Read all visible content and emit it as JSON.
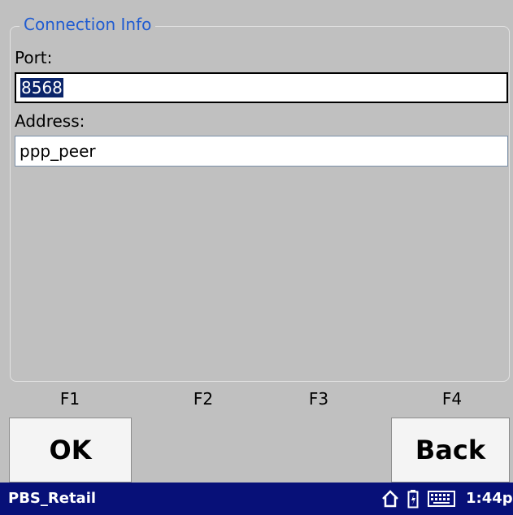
{
  "connection_group": {
    "title": "Connection Info",
    "port_label": "Port:",
    "port_value": "8568",
    "address_label": "Address:",
    "address_value": "ppp_peer"
  },
  "function_keys": [
    "F1",
    "F2",
    "F3",
    "F4"
  ],
  "buttons": {
    "ok_label": "OK",
    "back_label": "Back"
  },
  "taskbar": {
    "app_name": "PBS_Retail",
    "clock": "1:44p",
    "icons": [
      "home-icon",
      "battery-icon",
      "keyboard-icon"
    ]
  },
  "colors": {
    "background": "#c0c0c0",
    "group_title": "#1f5bd1",
    "taskbar": "#071078",
    "selection": "#0a246a"
  }
}
